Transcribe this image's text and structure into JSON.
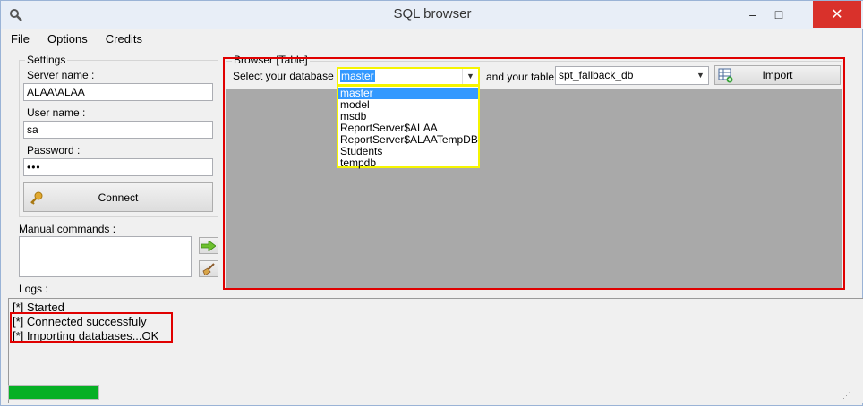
{
  "window": {
    "title": "SQL browser"
  },
  "titlebar": {
    "minimize": "–",
    "maximize": "□",
    "close": "✕"
  },
  "menu": {
    "items": [
      "File",
      "Options",
      "Credits"
    ]
  },
  "settings": {
    "legend": "Settings",
    "server_label": "Server name :",
    "server_value": "ALAA\\ALAA",
    "user_label": "User name :",
    "user_value": "sa",
    "password_label": "Password :",
    "password_value": "•••",
    "connect_label": "Connect"
  },
  "manual": {
    "label": "Manual commands :",
    "value": ""
  },
  "browser": {
    "legend": "Browser [Table]",
    "select_db_label": "Select your database :",
    "db_value": "master",
    "and_table_label": "and your table :",
    "table_value": "spt_fallback_db",
    "import_label": "Import",
    "db_options": [
      "master",
      "model",
      "msdb",
      "ReportServer$ALAA",
      "ReportServer$ALAATempDB",
      "Students",
      "tempdb"
    ]
  },
  "logs": {
    "label": "Logs :",
    "lines": [
      "[*] Started",
      "[*] Connected successfuly",
      "[*] Importing databases...OK"
    ]
  },
  "progress": {
    "percent": 10
  },
  "colors": {
    "highlight_box": "#e00000",
    "dropdown_border": "#f5f500",
    "selection": "#3399ff",
    "progress": "#06b025"
  }
}
